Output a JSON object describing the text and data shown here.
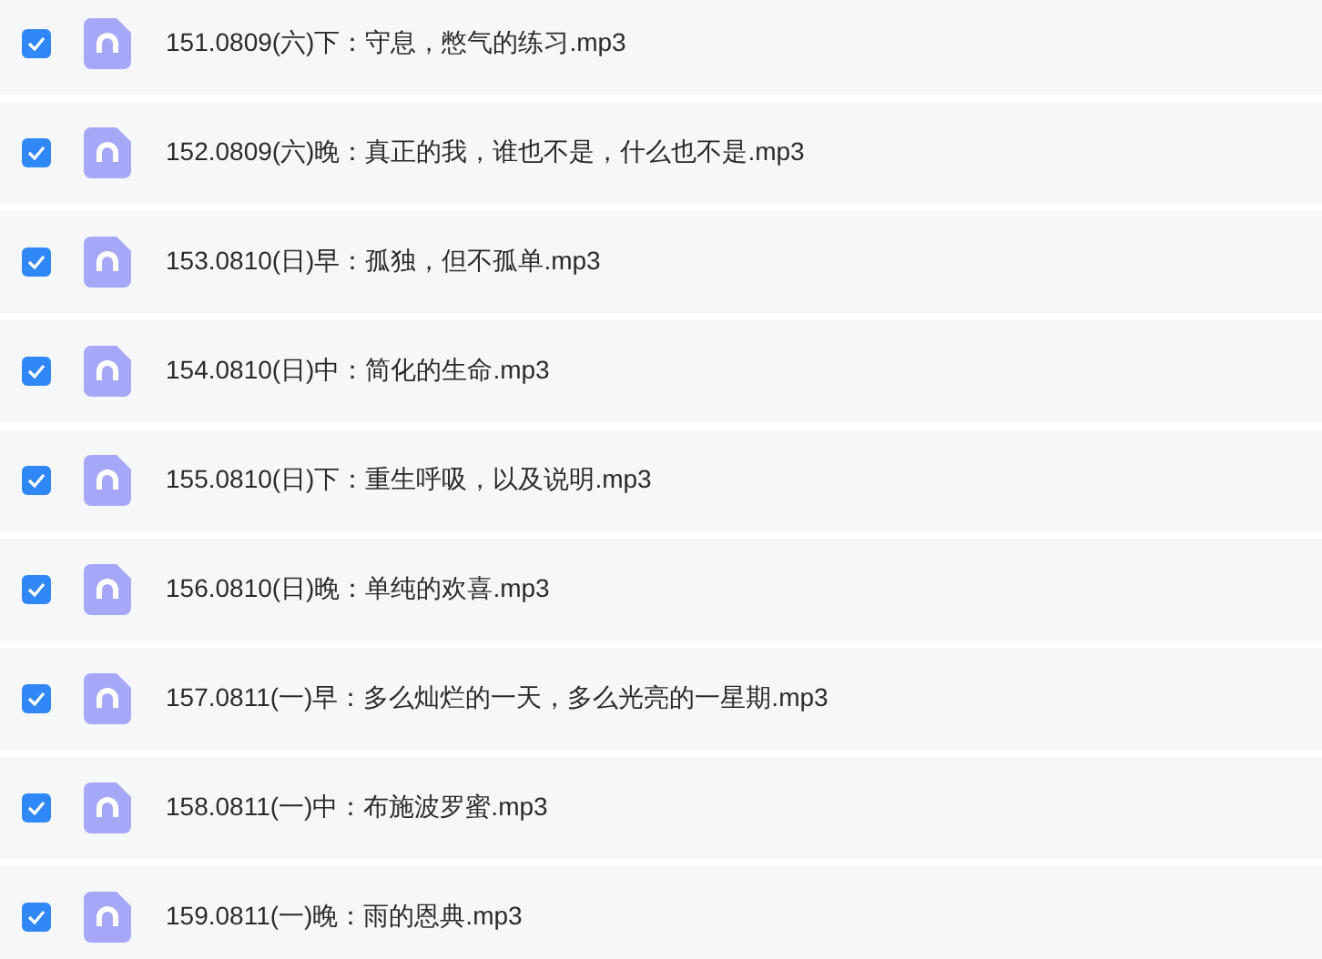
{
  "files": [
    {
      "name": "151.0809(六)下：守息，憋气的练习.mp3",
      "checked": true
    },
    {
      "name": "152.0809(六)晚：真正的我，谁也不是，什么也不是.mp3",
      "checked": true
    },
    {
      "name": "153.0810(日)早：孤独，但不孤单.mp3",
      "checked": true
    },
    {
      "name": "154.0810(日)中：简化的生命.mp3",
      "checked": true
    },
    {
      "name": "155.0810(日)下：重生呼吸，以及说明.mp3",
      "checked": true
    },
    {
      "name": "156.0810(日)晚：单纯的欢喜.mp3",
      "checked": true
    },
    {
      "name": "157.0811(一)早：多么灿烂的一天，多么光亮的一星期.mp3",
      "checked": true
    },
    {
      "name": "158.0811(一)中：布施波罗蜜.mp3",
      "checked": true
    },
    {
      "name": "159.0811(一)晚：雨的恩典.mp3",
      "checked": true
    }
  ]
}
